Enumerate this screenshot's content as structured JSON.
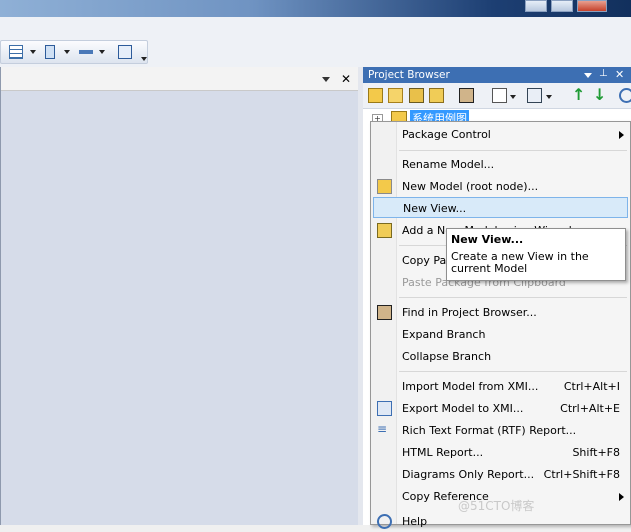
{
  "panel": {
    "title": "Project Browser",
    "root_node": "系统用例图"
  },
  "menu": {
    "items": [
      {
        "label": "Package Control",
        "shortcut": "",
        "submenu": true
      },
      {
        "label": "Rename Model...",
        "shortcut": ""
      },
      {
        "label": "New Model (root node)...",
        "shortcut": ""
      },
      {
        "label": "New View...",
        "shortcut": ""
      },
      {
        "label": "Add a New Model using Wizard...",
        "shortcut": ""
      },
      {
        "label": "Copy Package to Clipboard",
        "shortcut": ""
      },
      {
        "label": "Paste Package from Clipboard",
        "shortcut": ""
      },
      {
        "label": "Find in Project Browser...",
        "shortcut": ""
      },
      {
        "label": "Expand Branch",
        "shortcut": ""
      },
      {
        "label": "Collapse Branch",
        "shortcut": ""
      },
      {
        "label": "Import Model from XMI...",
        "shortcut": "Ctrl+Alt+I"
      },
      {
        "label": "Export Model to XMI...",
        "shortcut": "Ctrl+Alt+E"
      },
      {
        "label": "Rich Text Format (RTF) Report...",
        "shortcut": ""
      },
      {
        "label": "HTML Report...",
        "shortcut": "Shift+F8"
      },
      {
        "label": "Diagrams Only Report...",
        "shortcut": "Ctrl+Shift+F8"
      },
      {
        "label": "Copy Reference",
        "shortcut": "",
        "submenu": true
      },
      {
        "label": "Help",
        "shortcut": ""
      }
    ]
  },
  "tooltip": {
    "title": "New View...",
    "body": "Create a new View in the current Model"
  },
  "watermark": "@51CTO博客",
  "colors": {
    "panel_header": "#3d6fb3",
    "highlight": "#d8eaf9",
    "canvas": "#d6dce9"
  },
  "icons": [
    "minimize-icon",
    "maximize-icon",
    "close-icon",
    "table-icon",
    "panel-icon",
    "line-icon",
    "window-icon",
    "pin-icon",
    "new-package-icon",
    "new-folder-icon",
    "new-diagram-icon",
    "find-icon",
    "edit-icon",
    "properties-icon",
    "move-up-icon",
    "move-down-icon",
    "model-icon",
    "wizard-icon",
    "binoculars-icon",
    "export-icon",
    "rtf-icon",
    "help-icon"
  ]
}
